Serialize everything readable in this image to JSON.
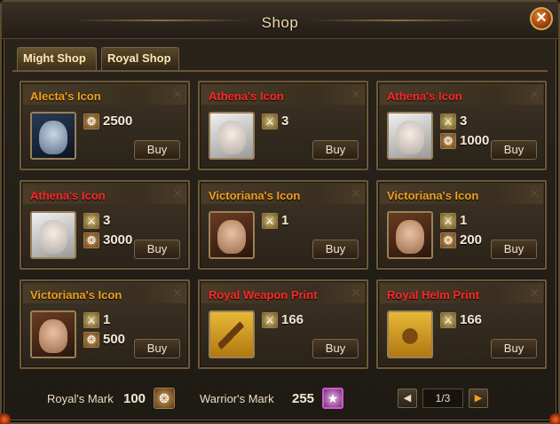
{
  "window": {
    "title": "Shop"
  },
  "tabs": [
    {
      "label": "Might Shop"
    },
    {
      "label": "Royal Shop"
    }
  ],
  "colors": {
    "name_gold": "#f0a020",
    "name_red": "#ff2828"
  },
  "items": [
    {
      "name": "Alecta's Icon",
      "name_color": "#f0a020",
      "portrait": "alecta",
      "costs": [
        {
          "icon": "royal-mark-icon",
          "value": "2500"
        }
      ],
      "buy": "Buy"
    },
    {
      "name": "Athena's Icon",
      "name_color": "#ff2828",
      "portrait": "athena",
      "costs": [
        {
          "icon": "warrior-mark-icon",
          "value": "3"
        }
      ],
      "buy": "Buy"
    },
    {
      "name": "Athena's Icon",
      "name_color": "#ff2828",
      "portrait": "athena",
      "costs": [
        {
          "icon": "warrior-mark-icon",
          "value": "3"
        },
        {
          "icon": "royal-mark-icon",
          "value": "1000"
        }
      ],
      "buy": "Buy"
    },
    {
      "name": "Athena's Icon",
      "name_color": "#ff2828",
      "portrait": "athena",
      "costs": [
        {
          "icon": "warrior-mark-icon",
          "value": "3"
        },
        {
          "icon": "royal-mark-icon",
          "value": "3000"
        }
      ],
      "buy": "Buy"
    },
    {
      "name": "Victoriana's Icon",
      "name_color": "#f0a020",
      "portrait": "victoriana",
      "costs": [
        {
          "icon": "warrior-mark-icon",
          "value": "1"
        }
      ],
      "buy": "Buy"
    },
    {
      "name": "Victoriana's Icon",
      "name_color": "#f0a020",
      "portrait": "victoriana",
      "costs": [
        {
          "icon": "warrior-mark-icon",
          "value": "1"
        },
        {
          "icon": "royal-mark-icon",
          "value": "200"
        }
      ],
      "buy": "Buy"
    },
    {
      "name": "Victoriana's Icon",
      "name_color": "#f0a020",
      "portrait": "victoriana",
      "costs": [
        {
          "icon": "warrior-mark-icon",
          "value": "1"
        },
        {
          "icon": "royal-mark-icon",
          "value": "500"
        }
      ],
      "buy": "Buy"
    },
    {
      "name": "Royal Weapon Print",
      "name_color": "#ff2828",
      "portrait": "weapon-scroll",
      "costs": [
        {
          "icon": "warrior-mark-icon",
          "value": "166"
        }
      ],
      "buy": "Buy"
    },
    {
      "name": "Royal Helm Print",
      "name_color": "#ff2828",
      "portrait": "helm-scroll",
      "costs": [
        {
          "icon": "warrior-mark-icon",
          "value": "166"
        }
      ],
      "buy": "Buy"
    }
  ],
  "footer": {
    "royal_label": "Royal's Mark",
    "royal_value": "100",
    "warrior_label": "Warrior's Mark",
    "warrior_value": "255",
    "page": "1/3"
  }
}
